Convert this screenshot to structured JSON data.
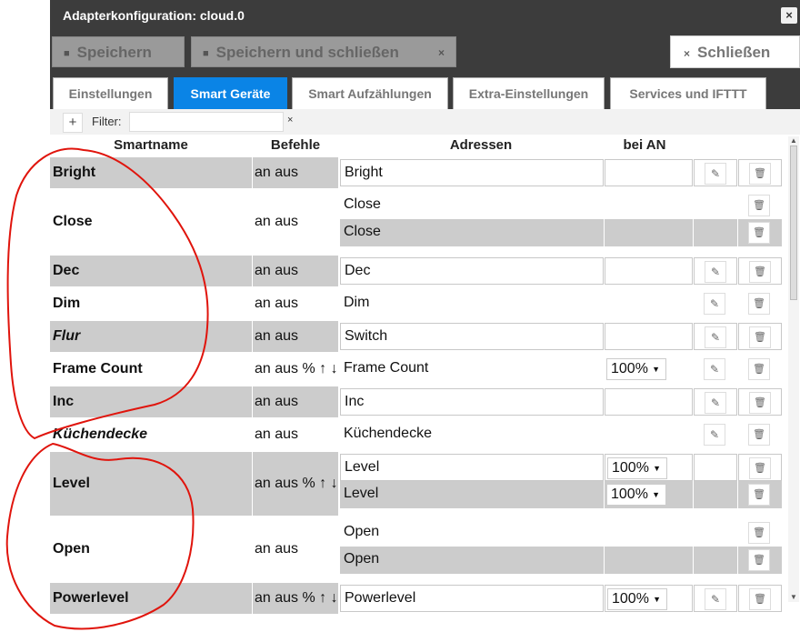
{
  "dialog": {
    "title": "Adapterkonfiguration: cloud.0",
    "close_icon": "×"
  },
  "toolbar": {
    "save_label": "Speichern",
    "save_close_label": "Speichern und schließen",
    "close_label": "Schließen",
    "x": "×",
    "save_icon": "floppy-icon"
  },
  "tabs": [
    {
      "label": "Einstellungen"
    },
    {
      "label": "Smart Geräte"
    },
    {
      "label": "Smart Aufzählungen"
    },
    {
      "label": "Extra-Einstellungen"
    },
    {
      "label": "Services und IFTTT"
    }
  ],
  "filter": {
    "plus": "+",
    "label": "Filter:",
    "value": "",
    "clear": "×"
  },
  "table": {
    "headers": {
      "smartname": "Smartname",
      "befehle": "Befehle",
      "adressen": "Adressen",
      "bei_an": "bei AN"
    },
    "rows": [
      {
        "name": "Bright",
        "commands": "an aus",
        "addresses": [
          {
            "text": "Bright",
            "on": "",
            "edit": true,
            "style": "boxed"
          }
        ]
      },
      {
        "name": "Close",
        "commands": "an aus",
        "addresses": [
          {
            "text": "Close",
            "on": "",
            "edit": false,
            "style": "plain"
          },
          {
            "text": "Close",
            "on": "",
            "edit": false,
            "style": "gray"
          }
        ]
      },
      {
        "name": "Dec",
        "commands": "an aus",
        "addresses": [
          {
            "text": "Dec",
            "on": "",
            "edit": true,
            "style": "boxed"
          }
        ]
      },
      {
        "name": "Dim",
        "commands": "an aus",
        "addresses": [
          {
            "text": "Dim",
            "on": "",
            "edit": true,
            "style": "plain"
          }
        ]
      },
      {
        "name": "Flur",
        "italic": true,
        "commands": "an aus",
        "addresses": [
          {
            "text": "Switch",
            "on": "",
            "edit": true,
            "style": "boxed"
          }
        ]
      },
      {
        "name": "Frame Count",
        "commands": "an aus % ↑ ↓",
        "addresses": [
          {
            "text": "Frame Count",
            "on": "100%",
            "edit": true,
            "style": "plain"
          }
        ]
      },
      {
        "name": "Inc",
        "commands": "an aus",
        "addresses": [
          {
            "text": "Inc",
            "on": "",
            "edit": true,
            "style": "boxed"
          }
        ]
      },
      {
        "name": "Küchendecke",
        "italic": true,
        "commands": "an aus",
        "addresses": [
          {
            "text": "Küchendecke",
            "on": "",
            "edit": true,
            "style": "plain"
          }
        ]
      },
      {
        "name": "Level",
        "commands": "an aus % ↑ ↓",
        "addresses": [
          {
            "text": "Level",
            "on": "100%",
            "edit": false,
            "style": "boxed"
          },
          {
            "text": "Level",
            "on": "100%",
            "edit": false,
            "style": "gray"
          }
        ]
      },
      {
        "name": "Open",
        "commands": "an aus",
        "addresses": [
          {
            "text": "Open",
            "on": "",
            "edit": false,
            "style": "plain"
          },
          {
            "text": "Open",
            "on": "",
            "edit": false,
            "style": "gray"
          }
        ]
      },
      {
        "name": "Powerlevel",
        "commands": "an aus % ↑ ↓",
        "addresses": [
          {
            "text": "Powerlevel",
            "on": "100%",
            "edit": true,
            "style": "boxed"
          }
        ]
      }
    ]
  },
  "icons": {
    "edit": "pencil-icon",
    "delete": "trash-icon",
    "dropdown": "caret-down-icon"
  },
  "colors": {
    "titlebar": "#3c3c3c",
    "active_tab": "#0a84e6",
    "row_gray": "#cccccc",
    "annotation": "#e0140c"
  }
}
